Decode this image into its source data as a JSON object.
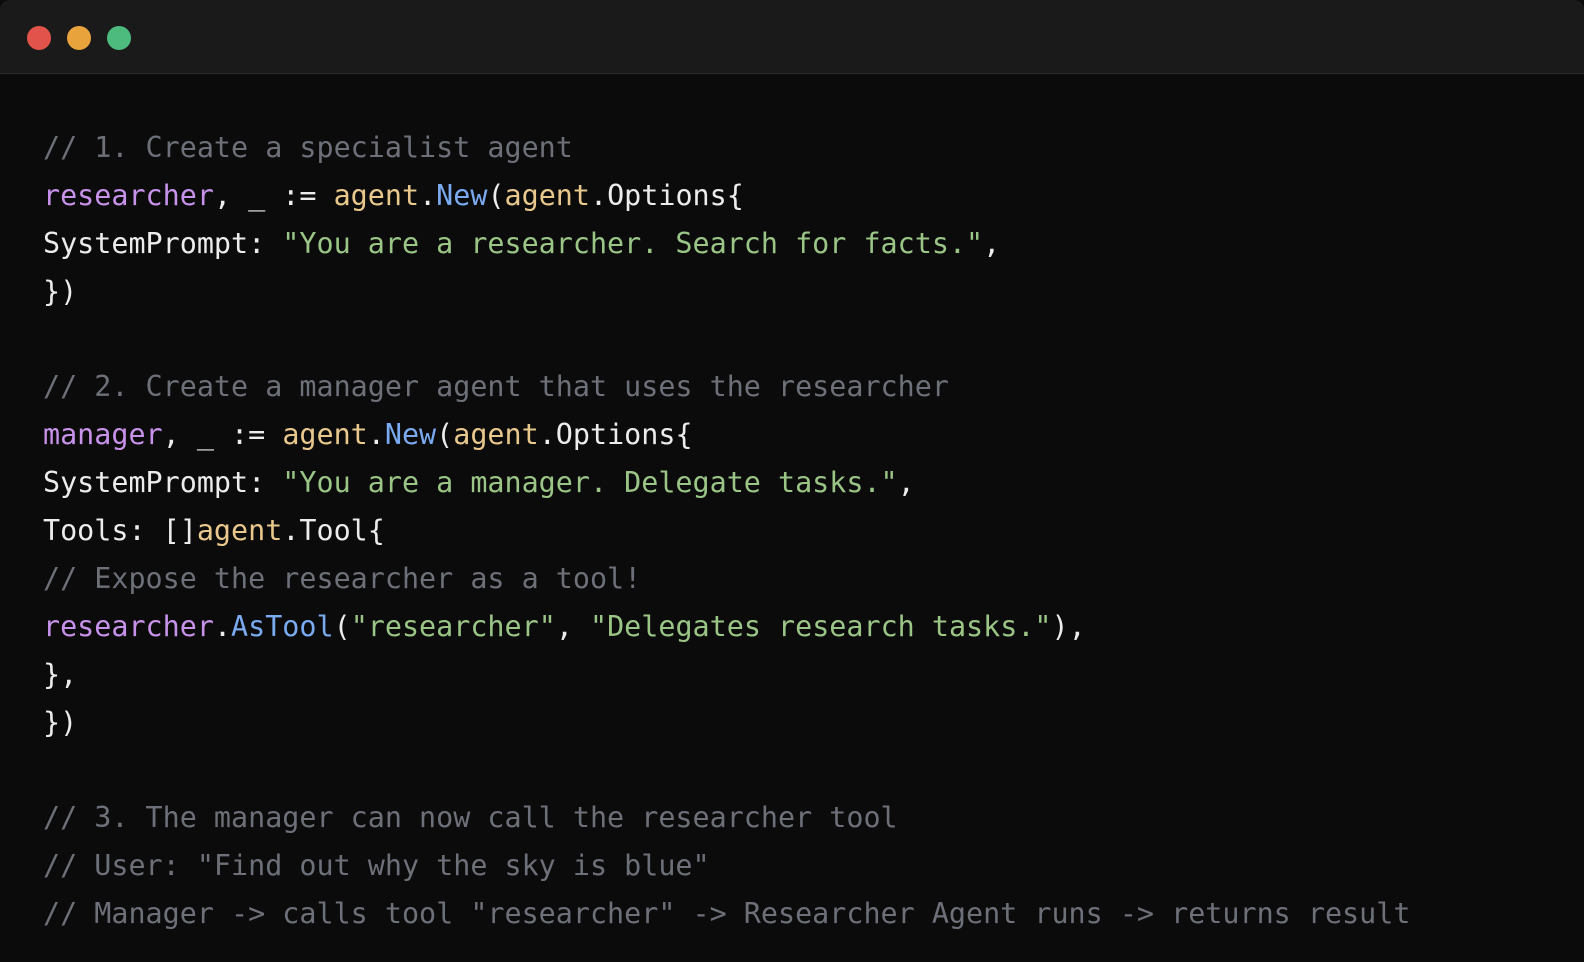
{
  "window": {
    "controls": [
      {
        "name": "close",
        "color": "#e2544b"
      },
      {
        "name": "minimize",
        "color": "#e8a33d"
      },
      {
        "name": "maximize",
        "color": "#4dbb7e"
      }
    ]
  },
  "colors": {
    "background": "#0b0b0b",
    "titlebar": "#1a1a1a",
    "comment": "#6e7079",
    "variable": "#c792ea",
    "package": "#e8c88c",
    "function": "#7aaaf0",
    "string": "#9ac586",
    "plain": "#ececec"
  },
  "code": {
    "lines": [
      [
        {
          "t": "comment",
          "v": "// 1. Create a specialist agent"
        }
      ],
      [
        {
          "t": "var",
          "v": "researcher"
        },
        {
          "t": "plain",
          "v": ", _ := "
        },
        {
          "t": "pkg",
          "v": "agent"
        },
        {
          "t": "plain",
          "v": "."
        },
        {
          "t": "func",
          "v": "New"
        },
        {
          "t": "plain",
          "v": "("
        },
        {
          "t": "pkg",
          "v": "agent"
        },
        {
          "t": "plain",
          "v": ".Options{"
        }
      ],
      [
        {
          "t": "plain",
          "v": "SystemPrompt: "
        },
        {
          "t": "string",
          "v": "\"You are a researcher. Search for facts.\""
        },
        {
          "t": "plain",
          "v": ","
        }
      ],
      [
        {
          "t": "plain",
          "v": "})"
        }
      ],
      [],
      [
        {
          "t": "comment",
          "v": "// 2. Create a manager agent that uses the researcher"
        }
      ],
      [
        {
          "t": "var",
          "v": "manager"
        },
        {
          "t": "plain",
          "v": ", _ := "
        },
        {
          "t": "pkg",
          "v": "agent"
        },
        {
          "t": "plain",
          "v": "."
        },
        {
          "t": "func",
          "v": "New"
        },
        {
          "t": "plain",
          "v": "("
        },
        {
          "t": "pkg",
          "v": "agent"
        },
        {
          "t": "plain",
          "v": ".Options{"
        }
      ],
      [
        {
          "t": "plain",
          "v": "SystemPrompt: "
        },
        {
          "t": "string",
          "v": "\"You are a manager. Delegate tasks.\""
        },
        {
          "t": "plain",
          "v": ","
        }
      ],
      [
        {
          "t": "plain",
          "v": "Tools: []"
        },
        {
          "t": "pkg",
          "v": "agent"
        },
        {
          "t": "plain",
          "v": ".Tool{"
        }
      ],
      [
        {
          "t": "comment",
          "v": "// Expose the researcher as a tool!"
        }
      ],
      [
        {
          "t": "var",
          "v": "researcher"
        },
        {
          "t": "plain",
          "v": "."
        },
        {
          "t": "func",
          "v": "AsTool"
        },
        {
          "t": "plain",
          "v": "("
        },
        {
          "t": "string",
          "v": "\"researcher\""
        },
        {
          "t": "plain",
          "v": ", "
        },
        {
          "t": "string",
          "v": "\"Delegates research tasks.\""
        },
        {
          "t": "plain",
          "v": "),"
        }
      ],
      [
        {
          "t": "plain",
          "v": "},"
        }
      ],
      [
        {
          "t": "plain",
          "v": "})"
        }
      ],
      [],
      [
        {
          "t": "comment",
          "v": "// 3. The manager can now call the researcher tool"
        }
      ],
      [
        {
          "t": "comment",
          "v": "// User: \"Find out why the sky is blue\""
        }
      ],
      [
        {
          "t": "comment",
          "v": "// Manager -> calls tool \"researcher\" -> Researcher Agent runs -> returns result"
        }
      ]
    ]
  }
}
